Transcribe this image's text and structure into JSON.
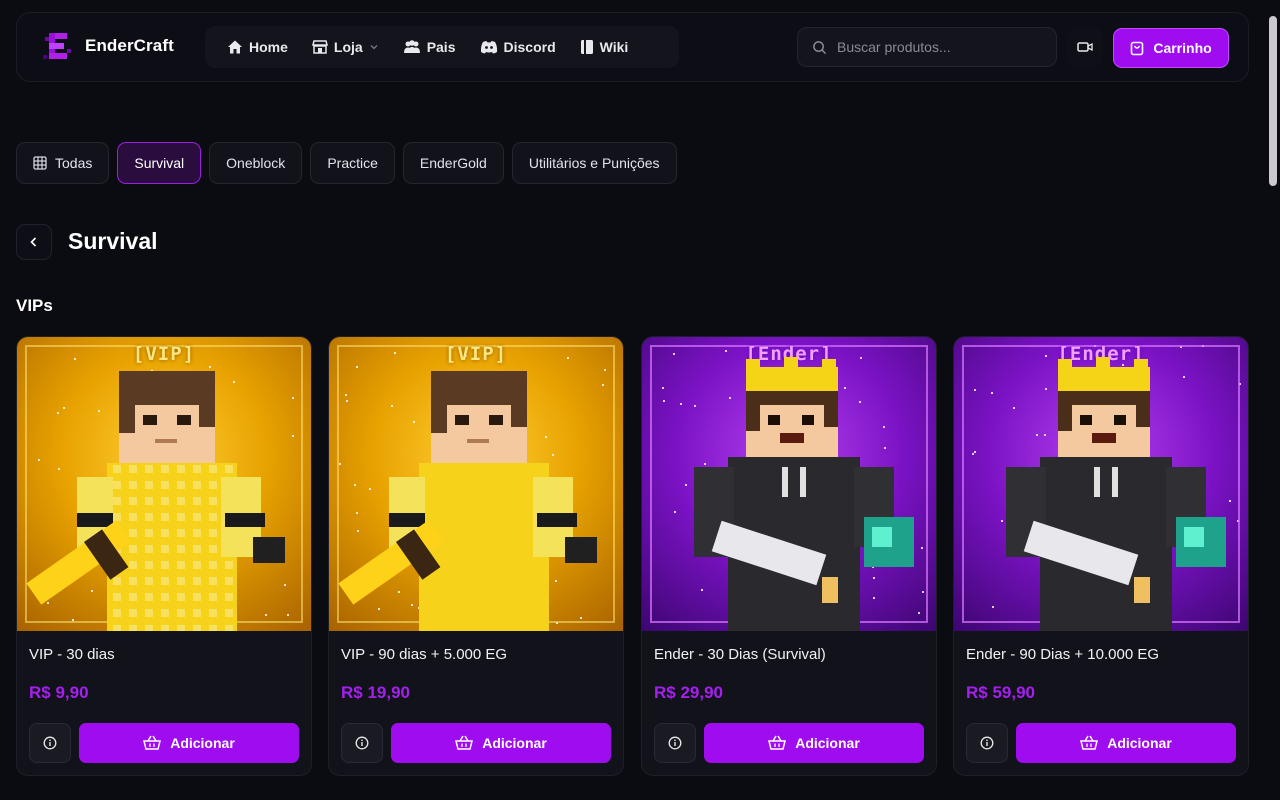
{
  "brand": {
    "name": "EnderCraft"
  },
  "nav": [
    {
      "label": "Home",
      "icon": "home-icon"
    },
    {
      "label": "Loja",
      "icon": "store-icon",
      "dropdown": true
    },
    {
      "label": "Pais",
      "icon": "users-icon"
    },
    {
      "label": "Discord",
      "icon": "discord-icon"
    },
    {
      "label": "Wiki",
      "icon": "book-icon"
    }
  ],
  "search": {
    "placeholder": "Buscar produtos..."
  },
  "cart": {
    "label": "Carrinho"
  },
  "categories": [
    {
      "label": "Todas",
      "icon": "grid-icon",
      "active": false
    },
    {
      "label": "Survival",
      "active": true
    },
    {
      "label": "Oneblock",
      "active": false
    },
    {
      "label": "Practice",
      "active": false
    },
    {
      "label": "EnderGold",
      "active": false
    },
    {
      "label": "Utilitários e Punições",
      "active": false
    }
  ],
  "section": {
    "title": "Survival",
    "subtitle": "VIPs"
  },
  "products": [
    {
      "name": "VIP - 30 dias",
      "price": "R$ 9,90",
      "badge": "[VIP]",
      "theme": "gold",
      "button": "Adicionar"
    },
    {
      "name": "VIP - 90 dias + 5.000 EG",
      "price": "R$ 19,90",
      "badge": "[VIP]",
      "theme": "gold",
      "button": "Adicionar"
    },
    {
      "name": "Ender - 30 Dias (Survival)",
      "price": "R$ 29,90",
      "badge": "[Ender]",
      "theme": "purple",
      "button": "Adicionar"
    },
    {
      "name": "Ender - 90 Dias + 10.000 EG",
      "price": "R$ 59,90",
      "badge": "[Ender]",
      "theme": "purple",
      "button": "Adicionar"
    }
  ],
  "colors": {
    "accent": "#a00cf0",
    "price": "#a51ff0",
    "background": "#0b0b12"
  }
}
